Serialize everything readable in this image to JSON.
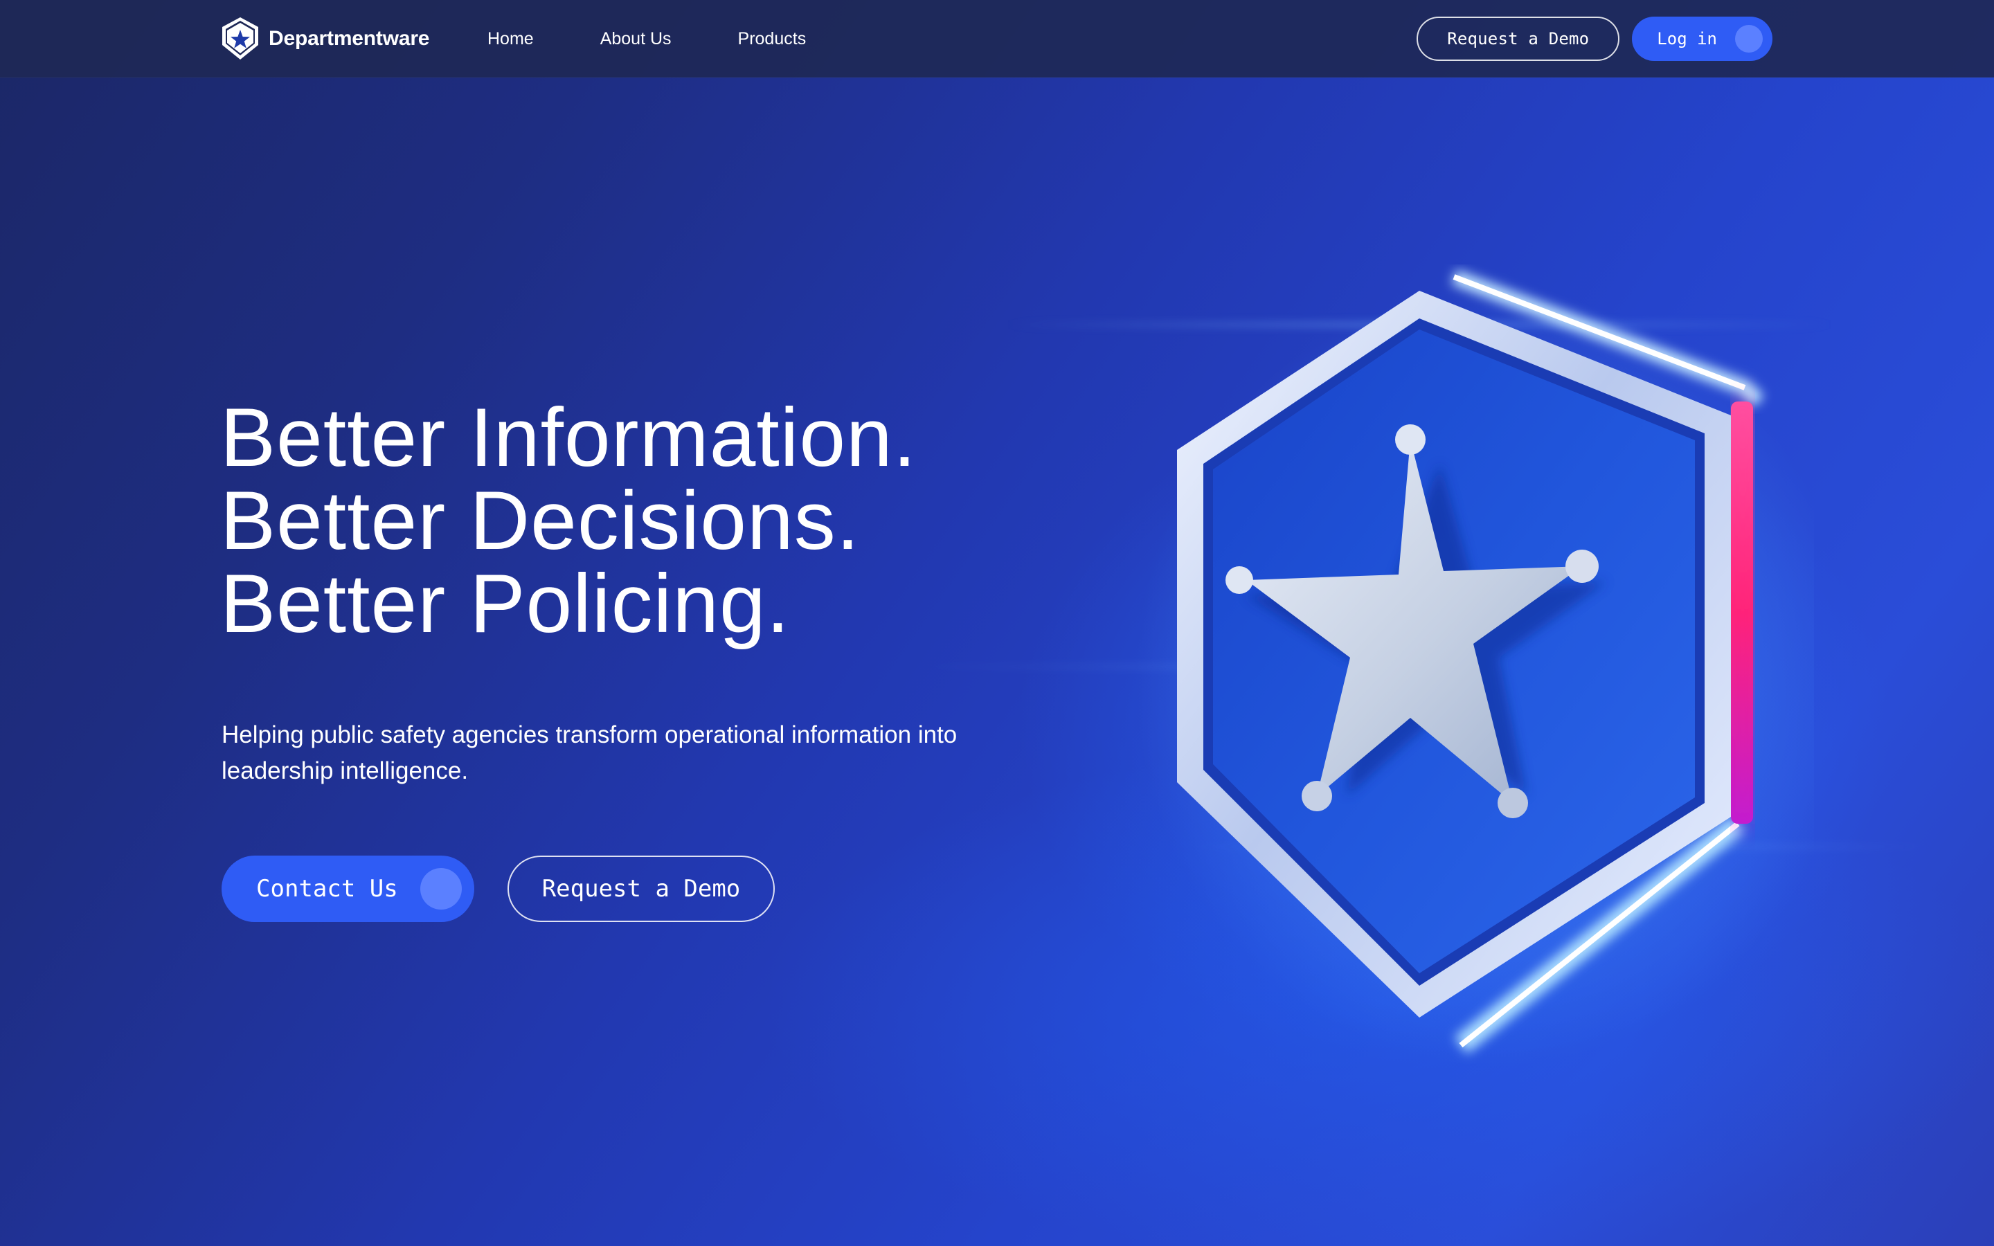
{
  "navbar": {
    "brand_name": "Departmentware",
    "links": [
      {
        "label": "Home"
      },
      {
        "label": "About Us"
      },
      {
        "label": "Products"
      }
    ],
    "request_demo_label": "Request a Demo",
    "login_label": "Log in"
  },
  "hero": {
    "title_lines": [
      "Better Information.",
      "Better Decisions.",
      "Better Policing."
    ],
    "subtitle": "Helping public safety agencies transform operational information into leadership intelligence.",
    "contact_label": "Contact Us",
    "request_demo_label": "Request a Demo"
  },
  "illustration": {
    "icon": "police-badge-star-icon"
  },
  "colors": {
    "accent": "#2f5cf5",
    "background_dark": "#1e2d82",
    "background_light": "#2a4dd8",
    "navbar": "#1e2856",
    "neon_pink": "#ff2e88"
  }
}
